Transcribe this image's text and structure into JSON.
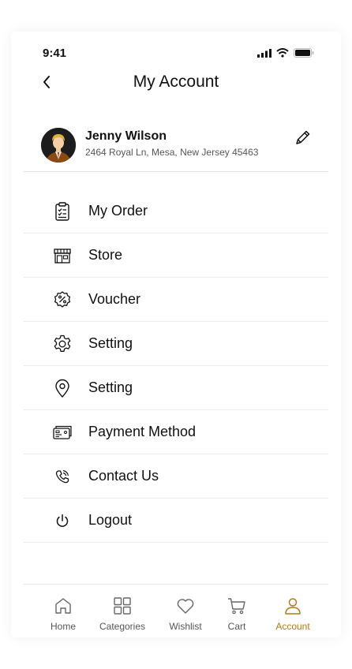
{
  "status_bar": {
    "time": "9:41"
  },
  "header": {
    "title": "My Account"
  },
  "profile": {
    "name": "Jenny Wilson",
    "address": "2464 Royal Ln, Mesa, New Jersey 45463"
  },
  "menu": {
    "items": [
      {
        "label": "My Order",
        "icon": "clipboard-icon"
      },
      {
        "label": "Store",
        "icon": "store-icon"
      },
      {
        "label": "Voucher",
        "icon": "voucher-icon"
      },
      {
        "label": "Setting",
        "icon": "gear-icon"
      },
      {
        "label": "Setting",
        "icon": "location-pin-icon"
      },
      {
        "label": "Payment Method",
        "icon": "card-icon"
      },
      {
        "label": "Contact Us",
        "icon": "phone-icon"
      },
      {
        "label": "Logout",
        "icon": "power-icon"
      }
    ]
  },
  "bottom_nav": {
    "items": [
      {
        "label": "Home",
        "icon": "home-icon",
        "active": false
      },
      {
        "label": "Categories",
        "icon": "grid-icon",
        "active": false
      },
      {
        "label": "Wishlist",
        "icon": "heart-icon",
        "active": false
      },
      {
        "label": "Cart",
        "icon": "cart-icon",
        "active": false
      },
      {
        "label": "Account",
        "icon": "user-icon",
        "active": true
      }
    ]
  },
  "colors": {
    "accent": "#b07a16",
    "text": "#111111",
    "muted": "#555555"
  }
}
